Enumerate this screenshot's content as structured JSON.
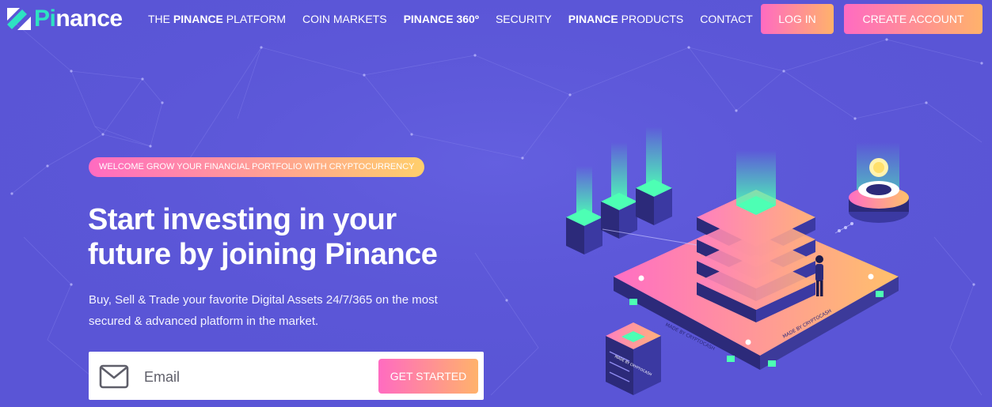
{
  "brand": {
    "name_accent": "Pi",
    "name_rest": "nance"
  },
  "nav": {
    "items": [
      {
        "bold": "",
        "text": "THE "
      },
      {
        "bold": "PINANCE",
        "text": " PLATFORM"
      },
      {
        "text": "COIN MARKETS"
      },
      {
        "bold": "PINANCE",
        "text": " 360º"
      },
      {
        "text": "SECURITY"
      },
      {
        "bold": "PINANCE",
        "text": " PRODUCTS"
      },
      {
        "text": "CONTACT"
      }
    ],
    "platform": {
      "pre": "THE ",
      "bold": "PINANCE",
      "post": " PLATFORM"
    },
    "coin_markets": "COIN MARKETS",
    "p360": {
      "bold": "PINANCE",
      "post": " 360º"
    },
    "security": "SECURITY",
    "products": {
      "bold": "PINANCE",
      "post": " PRODUCTS"
    },
    "contact": "CONTACT",
    "login": "LOG IN",
    "create_account": "CREATE ACCOUNT"
  },
  "hero": {
    "badge": "WELCOME GROW YOUR FINANCIAL PORTFOLIO WITH CRYPTOCURRENCY",
    "headline_line1": "Start investing in your",
    "headline_line2": "future by joining Pinance",
    "sub_line1": "Buy, Sell & Trade your favorite Digital Assets 24/7/365 on the most",
    "sub_line2": "secured & advanced platform in the market.",
    "email_placeholder": "Email",
    "cta": "GET STARTED"
  },
  "illustration": {
    "label_left": "MADE BY CRYPTOCASH",
    "label_right": "MADE BY CRYPTOCASH",
    "label_person": "MADE BY CRYPTOCASH"
  },
  "colors": {
    "background": "#5a55d6",
    "accent_teal": "#2ee2c2",
    "gradient_start": "#ff6bc1",
    "gradient_end": "#ffb26b"
  }
}
